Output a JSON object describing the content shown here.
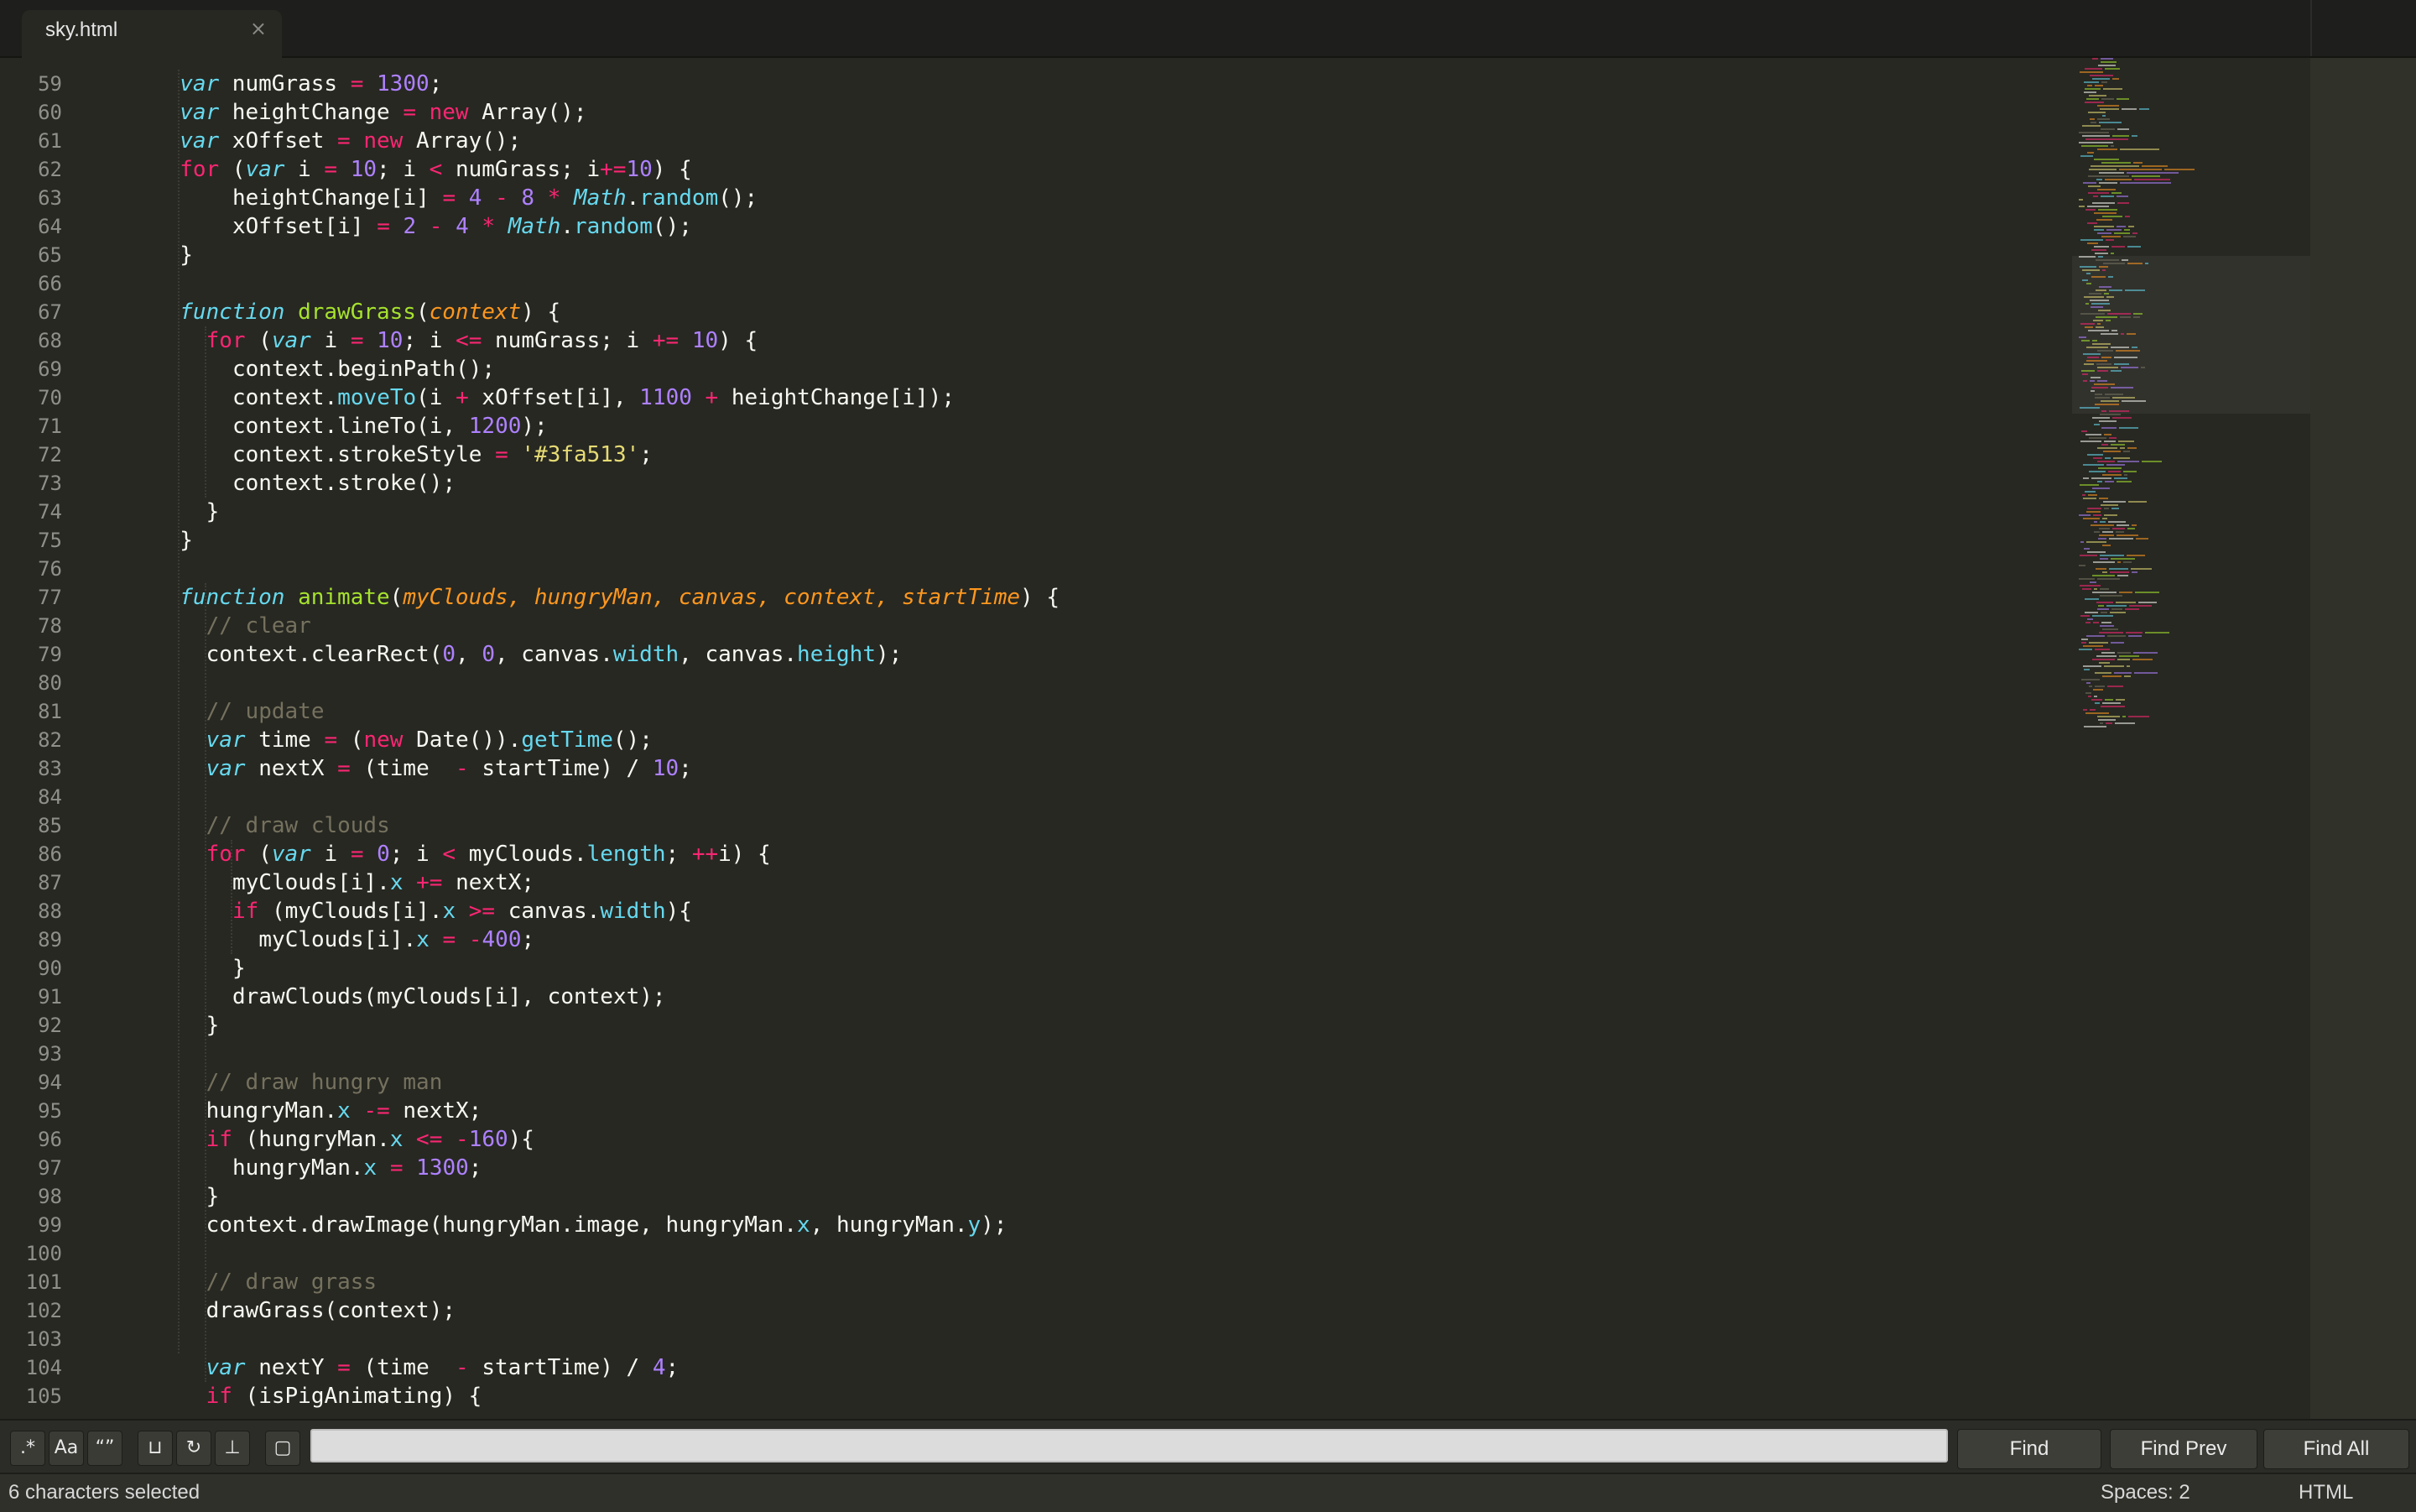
{
  "tab": {
    "title": "sky.html",
    "close_glyph": "×"
  },
  "colors": {
    "background": "#272822",
    "keyword": "#f92672",
    "storage": "#66d9ef",
    "function": "#a6e22e",
    "parameter": "#fd971f",
    "number": "#ae81ff",
    "string": "#e6db74",
    "comment": "#75715e",
    "text": "#f8f8f2"
  },
  "code": {
    "lines": [
      {
        "n": "59",
        "t": [
          [
            "st",
            "var"
          ],
          [
            "",
            "numGrass "
          ],
          [
            "op",
            "="
          ],
          [
            "",
            ""
          ],
          [
            "nu",
            " 1300"
          ],
          [
            "",
            ";"
          ]
        ],
        "indent": 6
      },
      {
        "n": "60",
        "t": [
          [
            "st",
            "var"
          ],
          [
            "",
            "heightChange "
          ],
          [
            "op",
            "="
          ],
          [
            "kw",
            " new"
          ],
          [
            "",
            " Array();"
          ]
        ],
        "indent": 6
      },
      {
        "n": "61",
        "t": [
          [
            "st",
            "var"
          ],
          [
            "",
            "xOffset "
          ],
          [
            "op",
            "="
          ],
          [
            "kw",
            " new"
          ],
          [
            "",
            " Array();"
          ]
        ],
        "indent": 6
      },
      {
        "n": "62",
        "t": [
          [
            "kw",
            "for"
          ],
          [
            "",
            " ("
          ],
          [
            "st",
            "var"
          ],
          [
            "",
            " i "
          ],
          [
            "op",
            "="
          ],
          [
            "nu",
            " 10"
          ],
          [
            "",
            "; i "
          ],
          [
            "op",
            "<"
          ],
          [
            "",
            " numGrass; i"
          ],
          [
            "op",
            "+="
          ],
          [
            "nu",
            "10"
          ],
          [
            "",
            ") {"
          ]
        ],
        "indent": 6
      },
      {
        "n": "63",
        "t": [
          [
            "",
            "heightChange[i] "
          ],
          [
            "op",
            "="
          ],
          [
            "nu",
            " 4"
          ],
          [
            "op",
            " -"
          ],
          [
            "nu",
            " 8"
          ],
          [
            "op",
            " *"
          ],
          [
            "st",
            " Math"
          ],
          [
            "",
            "."
          ],
          [
            "pr",
            "random"
          ],
          [
            "",
            "();"
          ]
        ],
        "indent": 10
      },
      {
        "n": "64",
        "t": [
          [
            "",
            "xOffset[i] "
          ],
          [
            "op",
            "="
          ],
          [
            "nu",
            " 2"
          ],
          [
            "op",
            " -"
          ],
          [
            "nu",
            " 4"
          ],
          [
            "op",
            " *"
          ],
          [
            "st",
            " Math"
          ],
          [
            "",
            "."
          ],
          [
            "pr",
            "random"
          ],
          [
            "",
            "();"
          ]
        ],
        "indent": 10
      },
      {
        "n": "65",
        "t": [
          [
            "",
            "}"
          ]
        ],
        "indent": 6
      },
      {
        "n": "66",
        "t": [],
        "indent": 0
      },
      {
        "n": "67",
        "t": [
          [
            "st",
            "function"
          ],
          [
            "fn",
            " drawGrass"
          ],
          [
            "",
            "("
          ],
          [
            "pm",
            "context"
          ],
          [
            "",
            ") {"
          ]
        ],
        "indent": 6
      },
      {
        "n": "68",
        "t": [
          [
            "kw",
            "for"
          ],
          [
            "",
            " ("
          ],
          [
            "st",
            "var"
          ],
          [
            "",
            " i "
          ],
          [
            "op",
            "="
          ],
          [
            "nu",
            " 10"
          ],
          [
            "",
            "; i "
          ],
          [
            "op",
            "<="
          ],
          [
            "",
            " numGrass; i "
          ],
          [
            "op",
            "+="
          ],
          [
            "nu",
            " 10"
          ],
          [
            "",
            ") {"
          ]
        ],
        "indent": 8
      },
      {
        "n": "69",
        "t": [
          [
            "",
            "context.beginPath();"
          ]
        ],
        "indent": 10
      },
      {
        "n": "70",
        "t": [
          [
            "",
            "context."
          ],
          [
            "pr",
            "moveTo"
          ],
          [
            "",
            "(i "
          ],
          [
            "op",
            "+"
          ],
          [
            "",
            " xOffset[i], "
          ],
          [
            "nu",
            "1100"
          ],
          [
            "op",
            " +"
          ],
          [
            "",
            " heightChange[i]);"
          ]
        ],
        "indent": 10
      },
      {
        "n": "71",
        "t": [
          [
            "",
            "context.lineTo(i, "
          ],
          [
            "nu",
            "1200"
          ],
          [
            "",
            ");"
          ]
        ],
        "indent": 10
      },
      {
        "n": "72",
        "t": [
          [
            "",
            "context.strokeStyle "
          ],
          [
            "op",
            "="
          ],
          [
            "str",
            " '#3fa513'"
          ],
          [
            "",
            ";"
          ]
        ],
        "indent": 10
      },
      {
        "n": "73",
        "t": [
          [
            "",
            "context.stroke();"
          ]
        ],
        "indent": 10
      },
      {
        "n": "74",
        "t": [
          [
            "",
            "}"
          ]
        ],
        "indent": 8
      },
      {
        "n": "75",
        "t": [
          [
            "",
            "}"
          ]
        ],
        "indent": 6
      },
      {
        "n": "76",
        "t": [],
        "indent": 0
      },
      {
        "n": "77",
        "t": [
          [
            "st",
            "function"
          ],
          [
            "fn",
            " animate"
          ],
          [
            "",
            "("
          ],
          [
            "pm",
            "myClouds, hungryMan, canvas, context, startTime"
          ],
          [
            "",
            ") {"
          ]
        ],
        "indent": 6
      },
      {
        "n": "78",
        "t": [
          [
            "cm",
            "// clear"
          ]
        ],
        "indent": 8
      },
      {
        "n": "79",
        "t": [
          [
            "",
            "context.clearRect("
          ],
          [
            "nu",
            "0"
          ],
          [
            "",
            ", "
          ],
          [
            "nu",
            "0"
          ],
          [
            "",
            ", canvas."
          ],
          [
            "pr",
            "width"
          ],
          [
            "",
            ", canvas."
          ],
          [
            "pr",
            "height"
          ],
          [
            "",
            ");"
          ]
        ],
        "indent": 8
      },
      {
        "n": "80",
        "t": [],
        "indent": 0
      },
      {
        "n": "81",
        "t": [
          [
            "cm",
            "// update"
          ]
        ],
        "indent": 8
      },
      {
        "n": "82",
        "t": [
          [
            "st",
            "var"
          ],
          [
            "",
            " time "
          ],
          [
            "op",
            "="
          ],
          [
            "",
            " ("
          ],
          [
            "kw",
            "new"
          ],
          [
            "",
            " Date())."
          ],
          [
            "pr",
            "getTime"
          ],
          [
            "",
            "();"
          ]
        ],
        "indent": 8
      },
      {
        "n": "83",
        "t": [
          [
            "st",
            "var"
          ],
          [
            "",
            " nextX "
          ],
          [
            "op",
            "="
          ],
          [
            "",
            " (time  "
          ],
          [
            "op",
            "-"
          ],
          [
            "",
            " startTime) / "
          ],
          [
            "nu",
            "10"
          ],
          [
            "",
            ";"
          ]
        ],
        "indent": 8
      },
      {
        "n": "84",
        "t": [],
        "indent": 0
      },
      {
        "n": "85",
        "t": [
          [
            "cm",
            "// draw clouds"
          ]
        ],
        "indent": 8
      },
      {
        "n": "86",
        "t": [
          [
            "kw",
            "for"
          ],
          [
            "",
            " ("
          ],
          [
            "st",
            "var"
          ],
          [
            "",
            " i "
          ],
          [
            "op",
            "="
          ],
          [
            "nu",
            " 0"
          ],
          [
            "",
            "; i "
          ],
          [
            "op",
            "<"
          ],
          [
            "",
            " myClouds."
          ],
          [
            "pr",
            "length"
          ],
          [
            "",
            "; "
          ],
          [
            "op",
            "++"
          ],
          [
            "",
            "i) {"
          ]
        ],
        "indent": 8
      },
      {
        "n": "87",
        "t": [
          [
            "",
            "myClouds[i]."
          ],
          [
            "pr",
            "x"
          ],
          [
            "op",
            " +="
          ],
          [
            "",
            " nextX;"
          ]
        ],
        "indent": 10
      },
      {
        "n": "88",
        "t": [
          [
            "kw",
            "if"
          ],
          [
            "",
            " (myClouds[i]."
          ],
          [
            "pr",
            "x"
          ],
          [
            "op",
            " >="
          ],
          [
            "",
            " canvas."
          ],
          [
            "pr",
            "width"
          ],
          [
            "",
            "){"
          ]
        ],
        "indent": 10
      },
      {
        "n": "89",
        "t": [
          [
            "",
            "myClouds[i]."
          ],
          [
            "pr",
            "x"
          ],
          [
            "op",
            " ="
          ],
          [
            "op",
            " -"
          ],
          [
            "nu",
            "400"
          ],
          [
            "",
            ";"
          ]
        ],
        "indent": 12
      },
      {
        "n": "90",
        "t": [
          [
            "",
            "}"
          ]
        ],
        "indent": 10
      },
      {
        "n": "91",
        "t": [
          [
            "",
            "drawClouds(myClouds[i], context);"
          ]
        ],
        "indent": 10
      },
      {
        "n": "92",
        "t": [
          [
            "",
            "}"
          ]
        ],
        "indent": 8
      },
      {
        "n": "93",
        "t": [],
        "indent": 0
      },
      {
        "n": "94",
        "t": [
          [
            "cm",
            "// draw hungry man"
          ]
        ],
        "indent": 8
      },
      {
        "n": "95",
        "t": [
          [
            "",
            "hungryMan."
          ],
          [
            "pr",
            "x"
          ],
          [
            "op",
            " -="
          ],
          [
            "",
            " nextX;"
          ]
        ],
        "indent": 8
      },
      {
        "n": "96",
        "t": [
          [
            "kw",
            "if"
          ],
          [
            "",
            " (hungryMan."
          ],
          [
            "pr",
            "x"
          ],
          [
            "op",
            " <="
          ],
          [
            "op",
            " -"
          ],
          [
            "nu",
            "160"
          ],
          [
            "",
            "){"
          ]
        ],
        "indent": 8
      },
      {
        "n": "97",
        "t": [
          [
            "",
            "hungryMan."
          ],
          [
            "pr",
            "x"
          ],
          [
            "op",
            " ="
          ],
          [
            "nu",
            " 1300"
          ],
          [
            "",
            ";"
          ]
        ],
        "indent": 10
      },
      {
        "n": "98",
        "t": [
          [
            "",
            "}"
          ]
        ],
        "indent": 8
      },
      {
        "n": "99",
        "t": [
          [
            "",
            "context.drawImage(hungryMan.image, hungryMan."
          ],
          [
            "pr",
            "x"
          ],
          [
            "",
            ", hungryMan."
          ],
          [
            "pr",
            "y"
          ],
          [
            "",
            ");"
          ]
        ],
        "indent": 8
      },
      {
        "n": "100",
        "t": [],
        "indent": 0
      },
      {
        "n": "101",
        "t": [
          [
            "cm",
            "// draw grass"
          ]
        ],
        "indent": 8
      },
      {
        "n": "102",
        "t": [
          [
            "",
            "drawGrass(context);"
          ]
        ],
        "indent": 8
      },
      {
        "n": "103",
        "t": [],
        "indent": 0
      },
      {
        "n": "104",
        "t": [
          [
            "st",
            "var"
          ],
          [
            "",
            " nextY "
          ],
          [
            "op",
            "="
          ],
          [
            "",
            " (time  "
          ],
          [
            "op",
            "-"
          ],
          [
            "",
            " startTime) / "
          ],
          [
            "nu",
            "4"
          ],
          [
            "",
            ";"
          ]
        ],
        "indent": 8
      },
      {
        "n": "105",
        "t": [
          [
            "kw",
            "if"
          ],
          [
            "",
            " (isPigAnimating) {"
          ]
        ],
        "indent": 8
      }
    ]
  },
  "find_panel": {
    "toggles": [
      {
        "name": "regex-toggle",
        "glyph": ".*"
      },
      {
        "name": "case-sensitive-toggle",
        "glyph": "Aa"
      },
      {
        "name": "whole-word-toggle",
        "glyph": "“”"
      },
      {
        "name": "in-selection-toggle",
        "glyph": "⊔"
      },
      {
        "name": "wrap-toggle",
        "glyph": "↻"
      },
      {
        "name": "preserve-case-toggle",
        "glyph": "⊥"
      },
      {
        "name": "highlight-matches-toggle",
        "glyph": "▢"
      }
    ],
    "search_value": "",
    "find_label": "Find",
    "find_prev_label": "Find Prev",
    "find_all_label": "Find All"
  },
  "status_bar": {
    "selection": "6 characters selected",
    "indentation": "Spaces: 2",
    "syntax": "HTML"
  }
}
